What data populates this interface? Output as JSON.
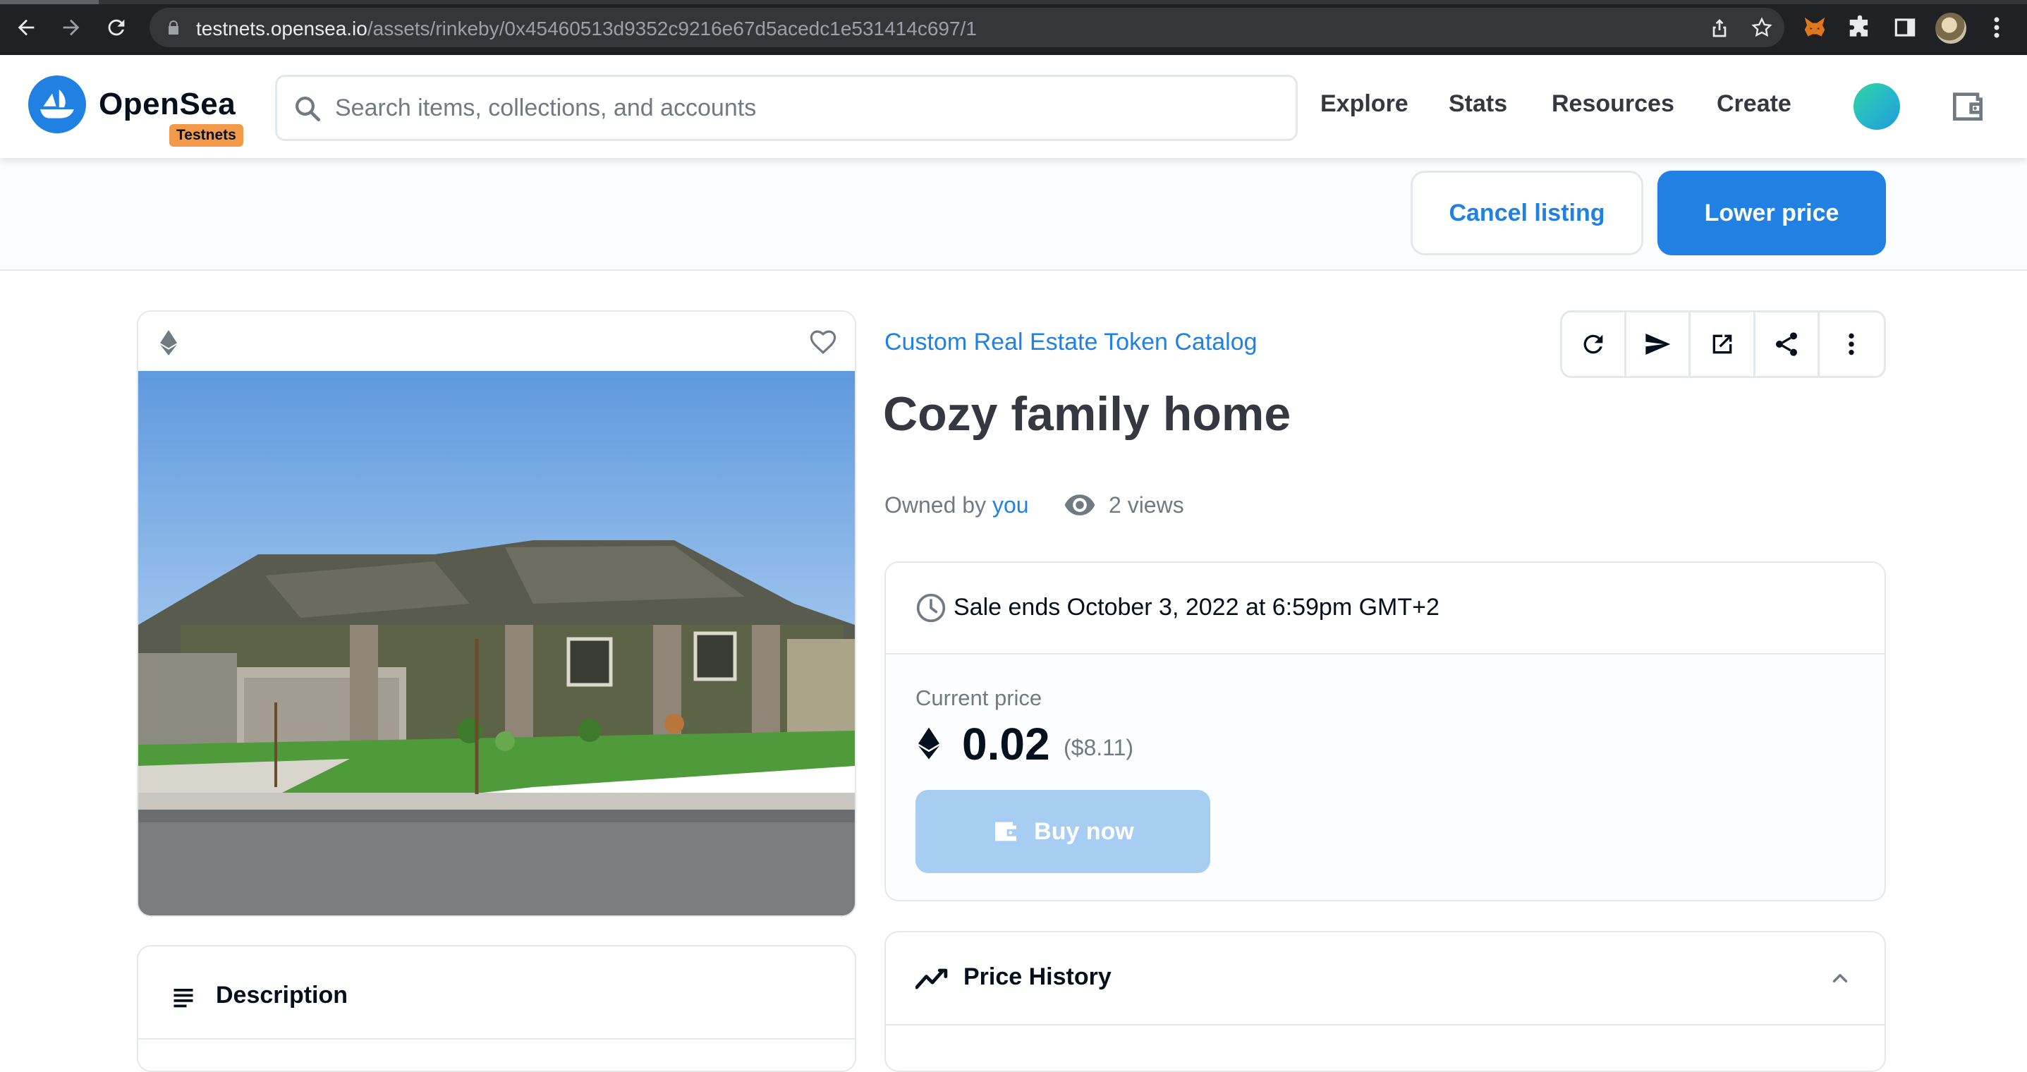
{
  "browser": {
    "url_host": "testnets.opensea.io",
    "url_path": "/assets/rinkeby/0x45460513d9352c9216e67d5acedc1e531414c697/1"
  },
  "header": {
    "logo_text": "OpenSea",
    "badge": "Testnets",
    "search_placeholder": "Search items, collections, and accounts",
    "nav": {
      "explore": "Explore",
      "stats": "Stats",
      "resources": "Resources",
      "create": "Create"
    }
  },
  "owner_actions": {
    "cancel_label": "Cancel listing",
    "lower_label": "Lower price"
  },
  "media": {
    "favorites_count": "0",
    "image_subject": "house-photo"
  },
  "description": {
    "title": "Description"
  },
  "item": {
    "collection": "Custom Real Estate Token Catalog",
    "title": "Cozy family home",
    "owned_by_prefix": "Owned by",
    "owner": "you",
    "views": "2 views"
  },
  "sale": {
    "ends_text": "Sale ends October 3, 2022 at 6:59pm GMT+2",
    "price_label": "Current price",
    "price": "0.02",
    "price_usd": "($8.11)",
    "buy_label": "Buy now"
  },
  "price_history": {
    "title": "Price History"
  },
  "colors": {
    "accent": "#2081e2",
    "badge": "#f2994a",
    "buy_disabled": "#a8cdf3"
  }
}
